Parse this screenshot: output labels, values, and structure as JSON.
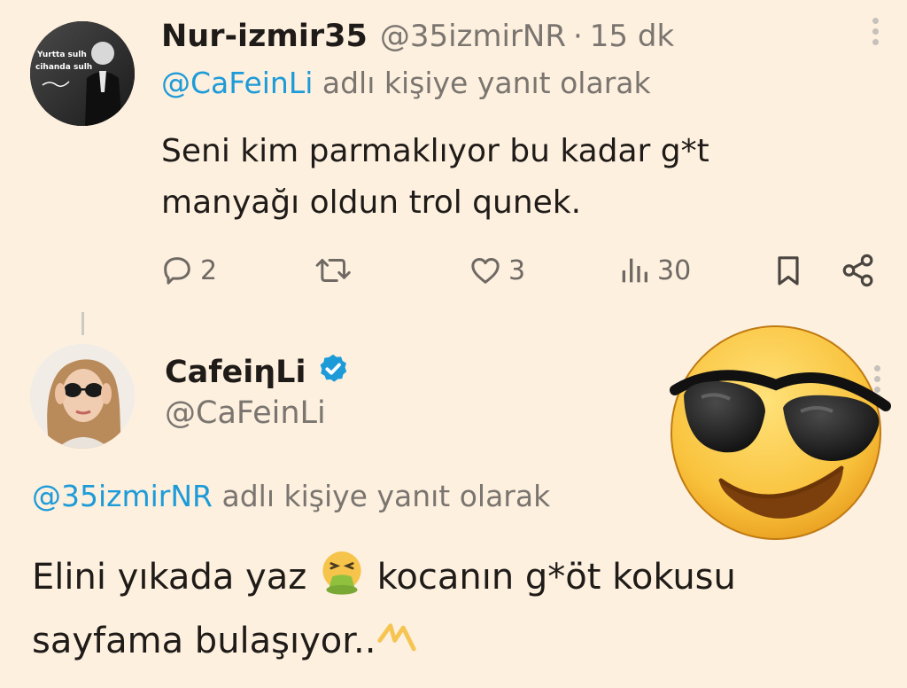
{
  "tweet1": {
    "display_name": "Nur-izmir35",
    "handle": "@35izmirNR",
    "separator": "·",
    "time": "15 dk",
    "reply_mention": "@CaFeinLi",
    "reply_suffix": "adlı kişiye yanıt olarak",
    "text": "Seni kim parmaklıyor bu kadar g*t manyağı oldun trol qunek.",
    "avatar_caption_line1": "Yurtta sulh",
    "avatar_caption_line2": "cihanda sulh",
    "stats": {
      "replies": "2",
      "retweets": "",
      "likes": "3",
      "views": "30"
    }
  },
  "tweet2": {
    "display_name": "CafeiηLi",
    "handle": "@CaFeinLi",
    "verified": true,
    "reply_mention": "@35izmirNR",
    "reply_suffix": "adlı kişiye yanıt olarak",
    "text_part1": "Elini yıkada yaz",
    "text_part2": "kocanın g*öt kokusu",
    "text_part3": "sayfama bulaşıyor..",
    "inline_emoji_1": "nauseated-vomiting-face",
    "inline_emoji_2": "lightning-zigzag"
  },
  "overlay": {
    "sticker": "smiling-face-with-sunglasses"
  },
  "colors": {
    "background": "#fdf0df",
    "mention": "#1d9bd8",
    "secondary_text": "#7b7570",
    "verified": "#1d9bd8"
  },
  "icons": {
    "reply": "reply-icon",
    "retweet": "retweet-icon",
    "like": "heart-icon",
    "views": "views-icon",
    "bookmark": "bookmark-icon",
    "share": "share-icon",
    "more": "more-icon"
  }
}
